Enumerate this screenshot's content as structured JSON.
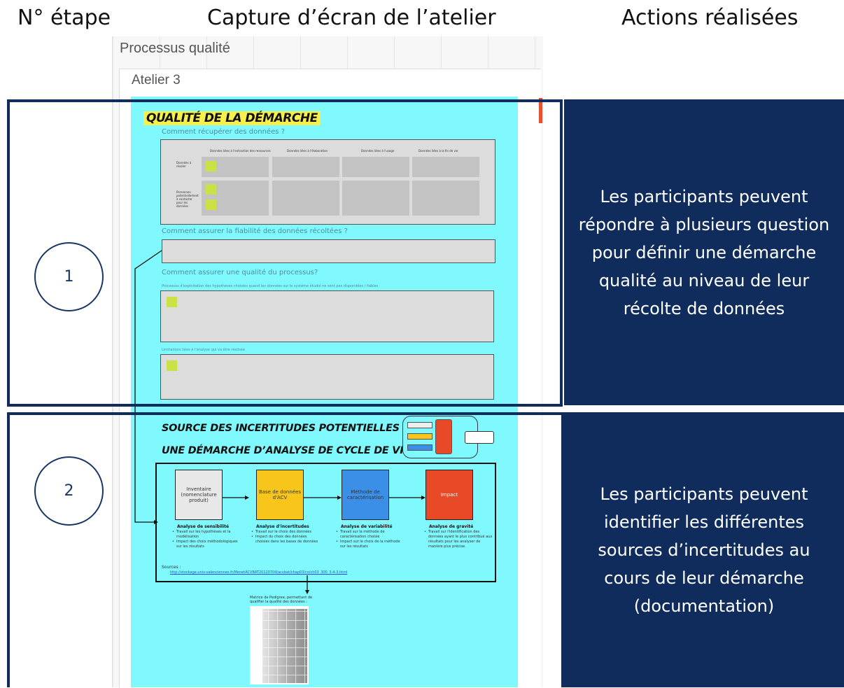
{
  "headers": {
    "step": "N° étape",
    "screenshot": "Capture d’écran de l’atelier",
    "actions": "Actions réalisées"
  },
  "board": {
    "title": "Processus qualité",
    "sheet_title": "Atelier 3"
  },
  "section1": {
    "title": "QUALITÉ DE LA DÉMARCHE",
    "q1": "Comment récupérer des données ?",
    "table_cols": [
      "Données liées à l'extraction des ressources",
      "Données liées à l'élaboration",
      "Données liées à l'usage",
      "Données liées à la fin de vie"
    ],
    "table_rows": [
      "Données à résoler",
      "Personnes potentiellement à contacter pour les données"
    ],
    "q2": "Comment assurer la fiabilité des données récoltées ?",
    "q3": "Comment assurer une qualité du processus?",
    "sub1": "Processus d'exploitation des hypothèses choisies quand les données sur le système étudié ne sont pas disponibles / fiables",
    "sub2": "Limitations liées à l'analyse qui va être réalisée"
  },
  "section2": {
    "title_line1": "SOURCE DES INCERTITUDES POTENTIELLES DANS",
    "title_line2": "UNE DÉMARCHE D’ANALYSE DE CYCLE DE VIE",
    "nodes": [
      {
        "label": "Inventaire (nomenclature produit)",
        "color": "#e8e8e8",
        "analysis": "Analyse de sensibilité",
        "bullets": [
          "Travail sur les hypothèses et la modélisation",
          "Impact des choix méthodologiques sur les résultats"
        ]
      },
      {
        "label": "Base de données d'ACV",
        "color": "#f8c61b",
        "analysis": "Analyse d'incertitudes",
        "bullets": [
          "Travail sur le choix des données",
          "Impact du choix des données choisies dans les bases de données"
        ]
      },
      {
        "label": "Méthode de caractérisation",
        "color": "#3b8fe6",
        "analysis": "Analyse de variabilité",
        "bullets": [
          "Travail sur la méthode de caractérisation choisie",
          "Impact sur le choix de la méthode sur les résultats"
        ]
      },
      {
        "label": "Impact",
        "color": "#e84a27",
        "analysis": "Analyse de gravité",
        "bullets": [
          "Travail sur l'identification des données ayant le plus contribué aux résultats pour les analyser de manière plus précise."
        ]
      }
    ],
    "sources_label": "Sources :",
    "sources_link": "http://stockage.univ-valenciennes.fr/MenetACVBAT20120704/acvbat/chap03/co/ch03_300_3-4-3.html",
    "pedigree": "Matrice de Pedigree, permettant de qualifier la qualité des données :"
  },
  "steps": [
    {
      "number": "1",
      "text": "Les participants peuvent répondre à plusieurs question pour définir une démarche qualité au niveau de leur récolte de données"
    },
    {
      "number": "2",
      "text": "Les participants peuvent identifier les différentes sources d’incertitudes au cours de leur démarche (documentation)"
    }
  ],
  "colors": {
    "navy": "#0f2c5c",
    "cyan": "#7ff9fd",
    "sticky": "#cbe145",
    "highlight": "#f7ef4a"
  }
}
